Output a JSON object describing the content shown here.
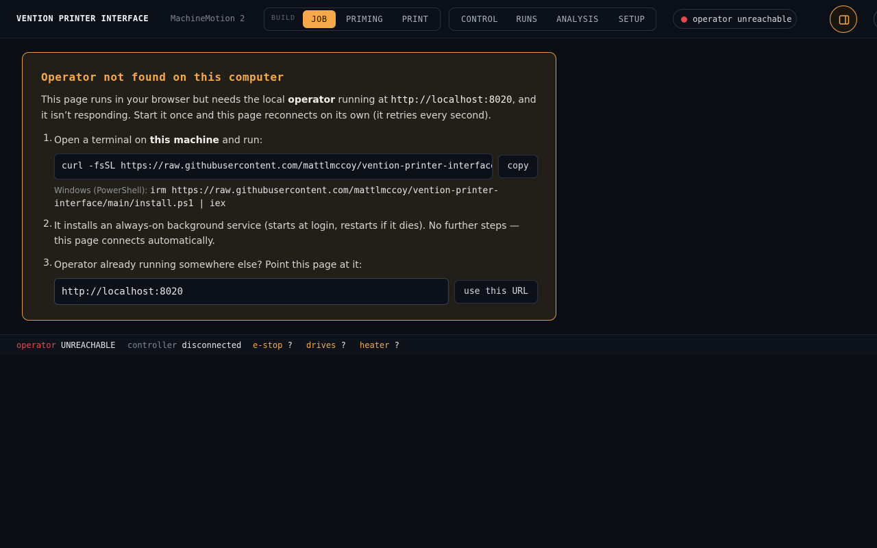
{
  "header": {
    "title": "VENTION PRINTER INTERFACE",
    "subtitle": "MachineMotion 2",
    "build_group_label": "BUILD",
    "build_tabs": [
      {
        "label": "JOB",
        "active": true
      },
      {
        "label": "PRIMING",
        "active": false
      },
      {
        "label": "PRINT",
        "active": false
      }
    ],
    "main_tabs": [
      {
        "label": "CONTROL"
      },
      {
        "label": "RUNS"
      },
      {
        "label": "ANALYSIS"
      },
      {
        "label": "SETUP"
      }
    ],
    "status": {
      "text": "operator unreachable",
      "color": "#e5484d"
    },
    "panel_toggle_icon": "sidebar-panel-icon"
  },
  "card": {
    "title": "Operator not found on this computer",
    "intro": {
      "p1": "This page runs in your browser but needs the local ",
      "b1": "operator",
      "p2": " running at ",
      "code": "http://localhost:8020",
      "p3": ", and it isn’t responding. Start it once and this page reconnects on its own (it retries every second)."
    },
    "steps": [
      {
        "num": "1.",
        "pre": "Open a terminal on ",
        "bold": "this machine",
        "post": " and run:"
      },
      {
        "num": "2.",
        "text": "It installs an always-on background service (starts at login, restarts if it dies). No further steps — this page connects automatically."
      },
      {
        "num": "3.",
        "text": "Operator already running somewhere else? Point this page at it:"
      }
    ],
    "command": "curl -fsSL https://raw.githubusercontent.com/mattlmccoy/vention-printer-interface/main/install.sh | bash",
    "copy_label": "copy",
    "windows_label": "Windows (PowerShell): ",
    "windows_command": "irm https://raw.githubusercontent.com/mattlmccoy/vention-printer-interface/main/install.ps1 | iex",
    "url_value": "http://localhost:8020",
    "use_url_label": "use this URL"
  },
  "statusbar": [
    {
      "key": "operator",
      "value": "UNREACHABLE",
      "key_color": "#e5484d"
    },
    {
      "key": "controller",
      "value": "disconnected",
      "key_color": "#7d8594"
    },
    {
      "key": "e-stop",
      "value": "?",
      "key_color": "#f5a94a"
    },
    {
      "key": "drives",
      "value": "?",
      "key_color": "#f5a94a"
    },
    {
      "key": "heater",
      "value": "?",
      "key_color": "#f5a94a"
    }
  ]
}
